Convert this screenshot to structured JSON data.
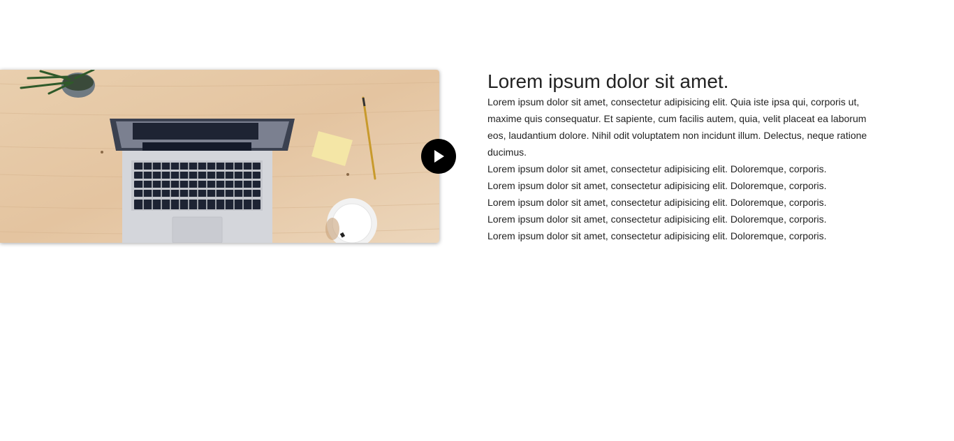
{
  "article": {
    "title": "Lorem ipsum dolor sit amet.",
    "paragraph": "Lorem ipsum dolor sit amet, consectetur adipisicing elit. Quia iste ipsa qui, corporis ut, maxime quis consequatur. Et sapiente, cum facilis autem, quia, velit placeat ea laborum eos, laudantium dolore. Nihil odit voluptatem non incidunt illum. Delectus, neque ratione ducimus.",
    "lines": [
      "Lorem ipsum dolor sit amet, consectetur adipisicing elit. Doloremque, corporis.",
      "Lorem ipsum dolor sit amet, consectetur adipisicing elit. Doloremque, corporis.",
      "Lorem ipsum dolor sit amet, consectetur adipisicing elit. Doloremque, corporis.",
      "Lorem ipsum dolor sit amet, consectetur adipisicing elit. Doloremque, corporis.",
      "Lorem ipsum dolor sit amet, consectetur adipisicing elit. Doloremque, corporis."
    ]
  },
  "media": {
    "icon": "play-icon",
    "scene": "laptop-on-desk-image"
  },
  "colors": {
    "desk": "#e6c9a8",
    "play_button": "#000000",
    "text": "#222222"
  }
}
